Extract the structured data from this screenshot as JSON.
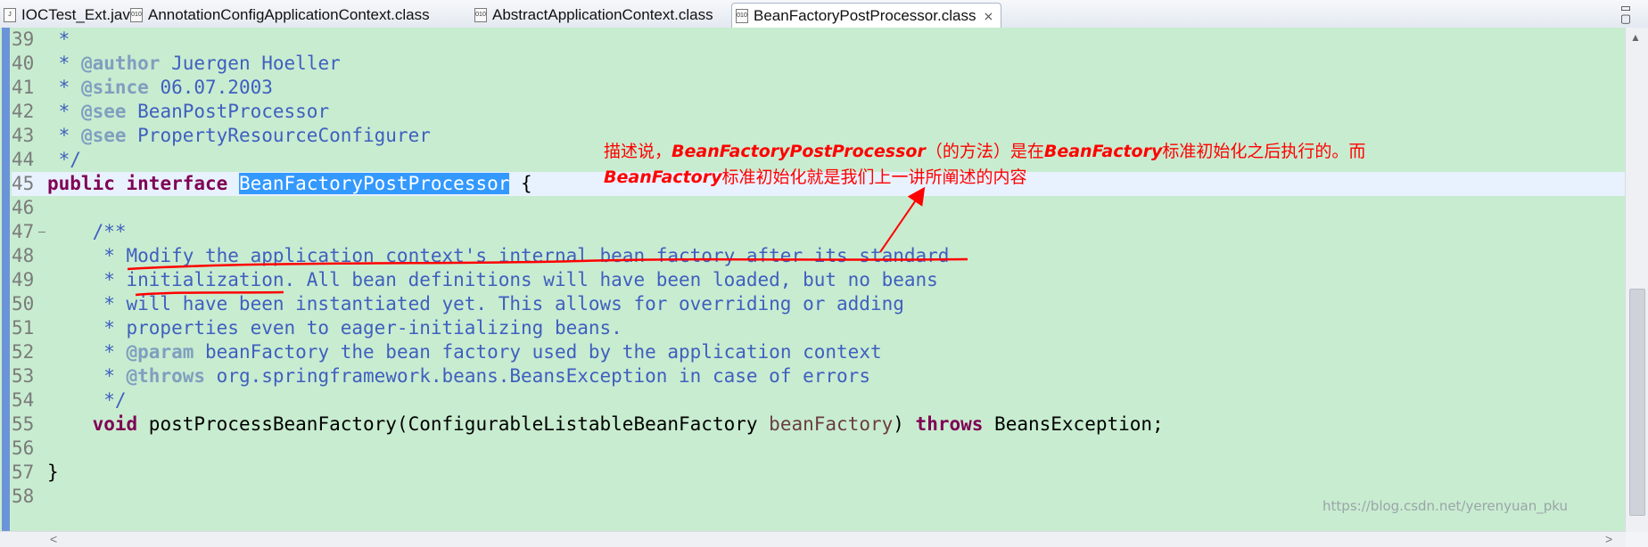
{
  "tabs": [
    {
      "label": "IOCTest_Ext.java",
      "icon": "java-file-icon",
      "active": false
    },
    {
      "label": "AnnotationConfigApplicationContext.class",
      "icon": "class-file-icon",
      "active": false
    },
    {
      "label": "AbstractApplicationContext.class",
      "icon": "class-file-icon",
      "active": false
    },
    {
      "label": "BeanFactoryPostProcessor.class",
      "icon": "class-file-icon",
      "active": true
    }
  ],
  "tab_close_glyph": "⨯",
  "window_buttons": [
    "▭",
    "▢"
  ],
  "lines": [
    {
      "num": "39",
      "parts": [
        {
          "t": " *",
          "c": "cm"
        }
      ]
    },
    {
      "num": "40",
      "parts": [
        {
          "t": " * ",
          "c": "cm"
        },
        {
          "t": "@author",
          "c": "tg"
        },
        {
          "t": " Juergen Hoeller",
          "c": "cm"
        }
      ]
    },
    {
      "num": "41",
      "parts": [
        {
          "t": " * ",
          "c": "cm"
        },
        {
          "t": "@since",
          "c": "tg"
        },
        {
          "t": " 06.07.2003",
          "c": "cm"
        }
      ]
    },
    {
      "num": "42",
      "parts": [
        {
          "t": " * ",
          "c": "cm"
        },
        {
          "t": "@see",
          "c": "tg"
        },
        {
          "t": " BeanPostProcessor",
          "c": "cm"
        }
      ]
    },
    {
      "num": "43",
      "parts": [
        {
          "t": " * ",
          "c": "cm"
        },
        {
          "t": "@see",
          "c": "tg"
        },
        {
          "t": " PropertyResourceConfigurer",
          "c": "cm"
        }
      ]
    },
    {
      "num": "44",
      "parts": [
        {
          "t": " */",
          "c": "cm"
        }
      ]
    },
    {
      "num": "45",
      "current": true,
      "parts": [
        {
          "t": "public",
          "c": "kw"
        },
        {
          "t": " ",
          "c": "plain"
        },
        {
          "t": "interface",
          "c": "kw"
        },
        {
          "t": " ",
          "c": "plain"
        },
        {
          "t": "BeanFactoryPostProcessor",
          "c": "sel"
        },
        {
          "t": " {",
          "c": "plain"
        }
      ]
    },
    {
      "num": "46",
      "parts": []
    },
    {
      "num": "47",
      "fold": true,
      "parts": [
        {
          "t": "    /**",
          "c": "cm"
        }
      ]
    },
    {
      "num": "48",
      "parts": [
        {
          "t": "     * Modify the application context's internal bean factory after its standard",
          "c": "cm"
        }
      ]
    },
    {
      "num": "49",
      "parts": [
        {
          "t": "     * initialization. All bean definitions will have been loaded, but no beans",
          "c": "cm"
        }
      ]
    },
    {
      "num": "50",
      "parts": [
        {
          "t": "     * will have been instantiated yet. This allows for overriding or adding",
          "c": "cm"
        }
      ]
    },
    {
      "num": "51",
      "parts": [
        {
          "t": "     * properties even to eager-initializing beans.",
          "c": "cm"
        }
      ]
    },
    {
      "num": "52",
      "parts": [
        {
          "t": "     * ",
          "c": "cm"
        },
        {
          "t": "@param",
          "c": "tg"
        },
        {
          "t": " beanFactory the bean factory used by the application context",
          "c": "cm"
        }
      ]
    },
    {
      "num": "53",
      "parts": [
        {
          "t": "     * ",
          "c": "cm"
        },
        {
          "t": "@throws",
          "c": "tg"
        },
        {
          "t": " org.springframework.beans.BeansException in case of errors",
          "c": "cm"
        }
      ]
    },
    {
      "num": "54",
      "parts": [
        {
          "t": "     */",
          "c": "cm"
        }
      ]
    },
    {
      "num": "55",
      "parts": [
        {
          "t": "    ",
          "c": "plain"
        },
        {
          "t": "void",
          "c": "kw"
        },
        {
          "t": " postProcessBeanFactory(ConfigurableListableBeanFactory ",
          "c": "plain"
        },
        {
          "t": "beanFactory",
          "c": "param"
        },
        {
          "t": ") ",
          "c": "plain"
        },
        {
          "t": "throws",
          "c": "kw"
        },
        {
          "t": " BeansException;",
          "c": "plain"
        }
      ]
    },
    {
      "num": "56",
      "parts": []
    },
    {
      "num": "57",
      "parts": [
        {
          "t": "}",
          "c": "plain"
        }
      ]
    },
    {
      "num": "58",
      "parts": []
    }
  ],
  "annotation": {
    "line1_a": "描述说，",
    "line1_b": "BeanFactoryPostProcessor",
    "line1_c": "（的方法）是在",
    "line1_d": "BeanFactory",
    "line1_e": "标准初始化之后执行的。而",
    "line2_a": "BeanFactory",
    "line2_b": "标准初始化就是我们上一讲所阐述的内容"
  },
  "scroll": {
    "up": "▲",
    "down": "▼",
    "left": "<",
    "right": ">"
  },
  "watermark": "https://blog.csdn.net/yerenyuan_pku",
  "colors": {
    "editor_bg": "#c8ecd0",
    "annotation": "#ff0000",
    "selection": "#3399ff"
  }
}
